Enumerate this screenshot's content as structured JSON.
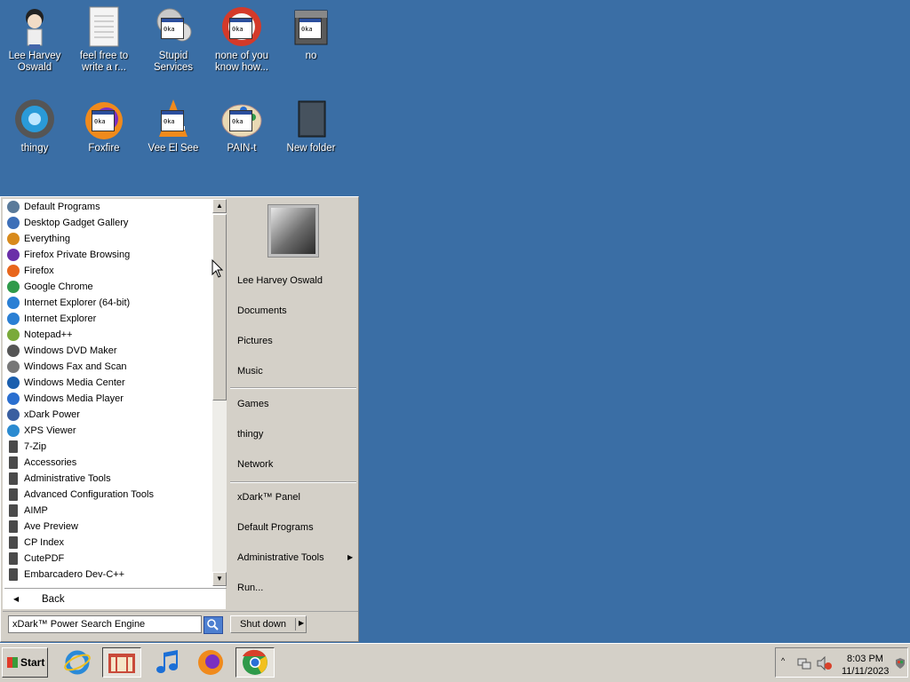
{
  "desktop": {
    "icons": [
      {
        "label": "Lee Harvey Oswald"
      },
      {
        "label": "feel free to write a r..."
      },
      {
        "label": "Stupid Services"
      },
      {
        "label": "none of you know how..."
      },
      {
        "label": "no"
      },
      {
        "label": "thingy"
      },
      {
        "label": "Foxfire"
      },
      {
        "label": "Vee El See"
      },
      {
        "label": "PAIN-t"
      },
      {
        "label": "New folder"
      }
    ]
  },
  "start_menu": {
    "programs": [
      {
        "label": "Default Programs",
        "icon": "default-programs-icon",
        "color": "#5a7a9a"
      },
      {
        "label": "Desktop Gadget Gallery",
        "icon": "gadget-icon",
        "color": "#3d6fb8"
      },
      {
        "label": "Everything",
        "icon": "magnifier-icon",
        "color": "#d88a1c"
      },
      {
        "label": "Firefox Private Browsing",
        "icon": "firefox-private-icon",
        "color": "#6b2fa8"
      },
      {
        "label": "Firefox",
        "icon": "firefox-icon",
        "color": "#e8661c"
      },
      {
        "label": "Google Chrome",
        "icon": "chrome-icon",
        "color": "#2f9a4a"
      },
      {
        "label": "Internet Explorer (64-bit)",
        "icon": "ie-icon",
        "color": "#2a7fd4"
      },
      {
        "label": "Internet Explorer",
        "icon": "ie-icon",
        "color": "#2a7fd4"
      },
      {
        "label": "Notepad++",
        "icon": "notepad-icon",
        "color": "#7aaa3a"
      },
      {
        "label": "Windows DVD Maker",
        "icon": "dvd-icon",
        "color": "#555555"
      },
      {
        "label": "Windows Fax and Scan",
        "icon": "fax-icon",
        "color": "#777777"
      },
      {
        "label": "Windows Media Center",
        "icon": "media-center-icon",
        "color": "#1b5fae"
      },
      {
        "label": "Windows Media Player",
        "icon": "media-player-icon",
        "color": "#2a6fd0"
      },
      {
        "label": "xDark Power",
        "icon": "xdark-icon",
        "color": "#3a5fa0"
      },
      {
        "label": "XPS Viewer",
        "icon": "xps-icon",
        "color": "#2a8ad0"
      },
      {
        "label": "7-Zip",
        "icon": "folder-icon",
        "color": "#4a4a4a"
      },
      {
        "label": "Accessories",
        "icon": "folder-icon",
        "color": "#4a4a4a"
      },
      {
        "label": "Administrative Tools",
        "icon": "folder-icon",
        "color": "#4a4a4a"
      },
      {
        "label": "Advanced Configuration Tools",
        "icon": "folder-icon",
        "color": "#4a4a4a"
      },
      {
        "label": "AIMP",
        "icon": "folder-icon",
        "color": "#4a4a4a"
      },
      {
        "label": "Ave Preview",
        "icon": "folder-icon",
        "color": "#4a4a4a"
      },
      {
        "label": "CP Index",
        "icon": "folder-icon",
        "color": "#4a4a4a"
      },
      {
        "label": "CutePDF",
        "icon": "folder-icon",
        "color": "#4a4a4a"
      },
      {
        "label": "Embarcadero Dev-C++",
        "icon": "folder-icon",
        "color": "#4a4a4a"
      }
    ],
    "back_label": "Back",
    "search": {
      "value": "xDark™ Power Search Engine"
    },
    "shutdown_label": "Shut down",
    "right": {
      "user": "Lee Harvey Oswald",
      "documents": "Documents",
      "pictures": "Pictures",
      "music": "Music",
      "games": "Games",
      "thingy": "thingy",
      "network": "Network",
      "panel": "xDark™ Panel",
      "default_programs": "Default Programs",
      "admin_tools": "Administrative Tools",
      "run": "Run..."
    }
  },
  "taskbar": {
    "start_label": "Start",
    "clock_time": "8:03 PM",
    "clock_date": "11/11/2023"
  }
}
